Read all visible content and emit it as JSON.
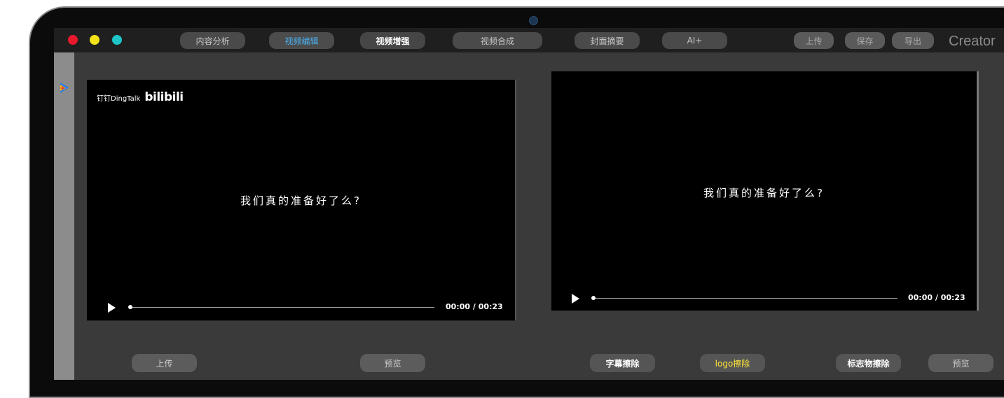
{
  "toolbar": {
    "tabs": [
      "内容分析",
      "视频编辑",
      "视频增强",
      "视频合成",
      "封面摘要",
      "AI+"
    ],
    "actions": [
      "上传",
      "保存",
      "导出"
    ],
    "brand": "Creator"
  },
  "left_video": {
    "watermark_text": "钉钉DingTalk",
    "watermark_logo": "bilibili",
    "subtitle": "我们真的准备好了么?",
    "time": "00:00 / 00:23",
    "progress": 0.0
  },
  "right_video": {
    "subtitle": "我们真的准备好了么?",
    "time": "00:00 / 00:23",
    "progress": 0.0
  },
  "bottom_buttons": {
    "upload": "上传",
    "preview_left": "预览",
    "subtitle_erase": "字幕擦除",
    "logo_erase": "logo擦除",
    "mark_erase": "标志物擦除",
    "preview_right": "预览"
  },
  "colors": {
    "active_tab": "#4ab3f4",
    "logo_erase_text": "#ffe438",
    "close": "#e8192c",
    "minimize": "#f3e318",
    "maximize": "#1dc5c7"
  }
}
